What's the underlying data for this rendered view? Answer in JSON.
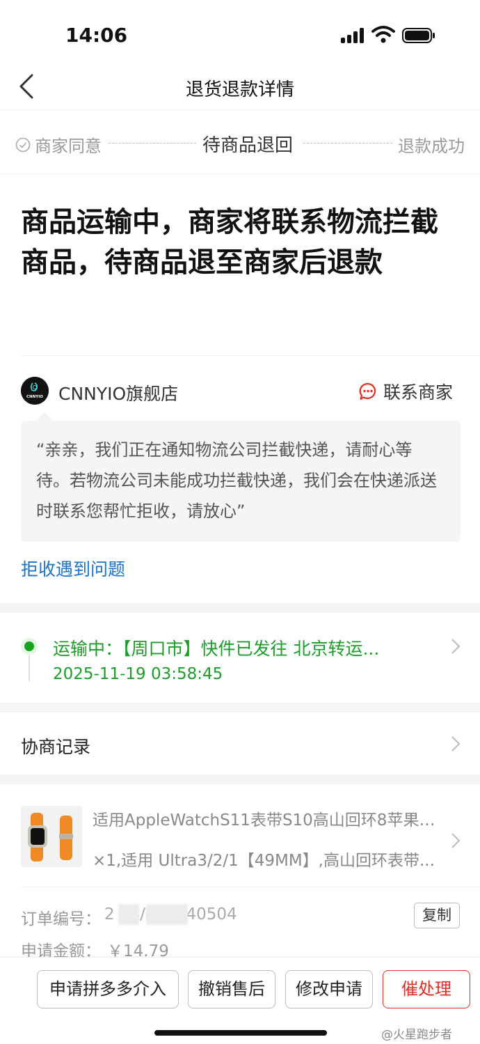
{
  "status_bar": {
    "time": "14:06"
  },
  "nav": {
    "title": "退货退款详情"
  },
  "steps": [
    {
      "label": "商家同意",
      "state": "done"
    },
    {
      "label": "待商品退回",
      "state": "current"
    },
    {
      "label": "退款成功",
      "state": "pending"
    }
  ],
  "headline": "商品运输中，商家将联系物流拦截商品，待商品退至商家后退款",
  "store": {
    "name": "CNNYIO旗舰店",
    "logo_text": "CNNYIO",
    "contact_label": "联系商家"
  },
  "merchant_message": "“亲亲，我们正在通知物流公司拦截快递，请耐心等待。若物流公司未能成功拦截快递，我们会在快递派送时联系您帮忙拒收，请放心”",
  "reject_problem_link": "拒收遇到问题",
  "logistics": {
    "status_text": "运输中：【周口市】快件已发往 北京转运...",
    "time": "2025-11-19 03:58:45"
  },
  "negotiation": {
    "label": "协商记录"
  },
  "product": {
    "title": "适用AppleWatchS11表带S10高山回环8苹果S...",
    "spec": "×1,适用 Ultra3/2/1【49MM】,高山回环表带..."
  },
  "order": {
    "number_label": "订单编号：",
    "number_value": "2    34/426140504",
    "copy_label": "复制",
    "amount_label": "申请金额：",
    "amount_value": "￥14.79"
  },
  "actions": {
    "intervene": "申请拼多多介入",
    "cancel": "撤销售后",
    "modify": "修改申请",
    "urge": "催处理"
  },
  "watermark": "@火星跑步者",
  "colors": {
    "accent_red": "#e02e24",
    "logistics_green": "#1a9e28",
    "link_blue": "#1a73c8"
  }
}
